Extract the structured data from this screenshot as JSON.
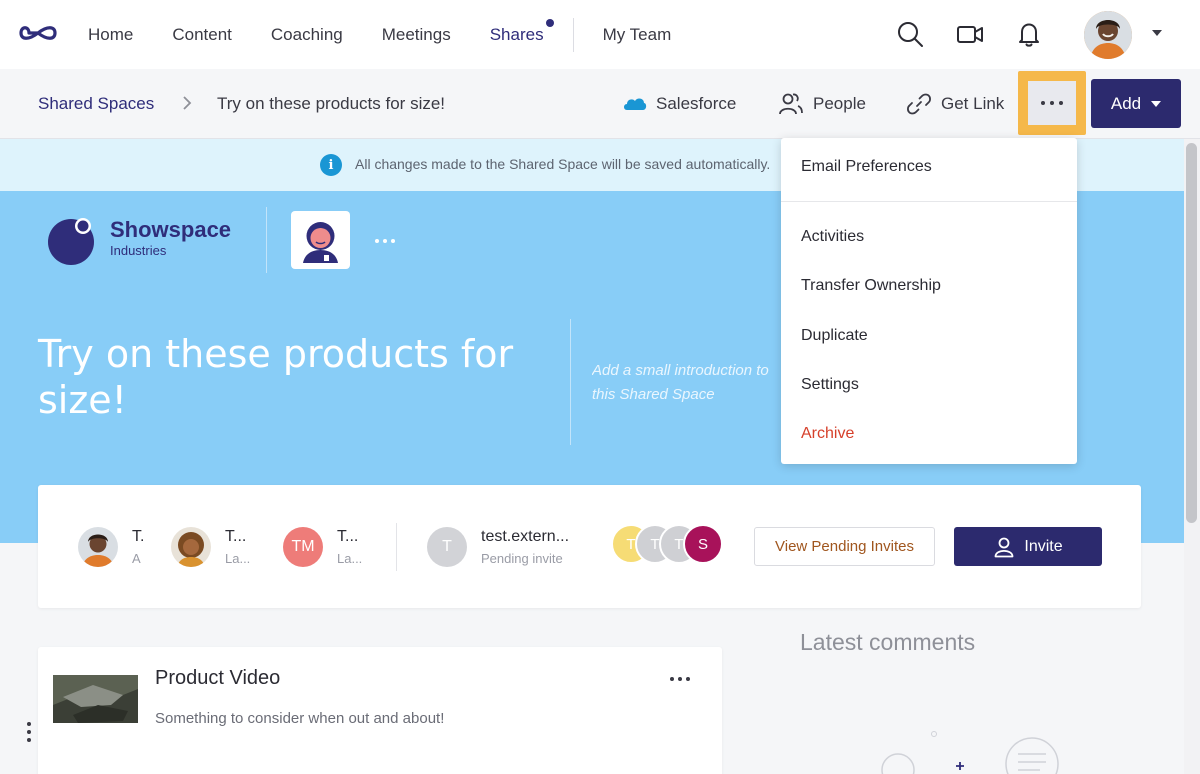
{
  "nav": {
    "items": [
      {
        "label": "Home"
      },
      {
        "label": "Content"
      },
      {
        "label": "Coaching"
      },
      {
        "label": "Meetings"
      },
      {
        "label": "Shares"
      },
      {
        "label": "My Team"
      }
    ]
  },
  "header": {
    "breadcrumb_root": "Shared Spaces",
    "breadcrumb_current": "Try on these products for size!",
    "salesforce": "Salesforce",
    "people": "People",
    "get_link": "Get Link",
    "add": "Add"
  },
  "banner": {
    "text": "All changes made to the Shared Space will be saved automatically."
  },
  "hero": {
    "brand_name": "Showspace",
    "brand_sub": "Industries",
    "title": "Try on these products for size!",
    "intro_placeholder": "Add a small introduction to this Shared Space"
  },
  "members": {
    "list": [
      {
        "name": "T.",
        "role": "A"
      },
      {
        "name": "T...",
        "role": "La..."
      },
      {
        "name": "T...",
        "role": "La...",
        "initials": "TM"
      }
    ],
    "pending": {
      "initial": "T",
      "name": "test.extern...",
      "status": "Pending invite"
    },
    "stack": [
      "T",
      "T",
      "T",
      "S"
    ],
    "view_pending": "View Pending Invites",
    "invite": "Invite"
  },
  "content": {
    "title": "Product Video",
    "description": "Something to consider when out and about!"
  },
  "comments": {
    "heading": "Latest comments"
  },
  "menu": {
    "email_preferences": "Email Preferences",
    "items": [
      {
        "label": "Activities"
      },
      {
        "label": "Transfer Ownership"
      },
      {
        "label": "Duplicate"
      },
      {
        "label": "Settings"
      },
      {
        "label": "Archive"
      }
    ]
  },
  "colors": {
    "brand": "#2f2d7a",
    "hero": "#88cdf7",
    "highlight": "#f5b84a",
    "danger": "#d6402b"
  }
}
